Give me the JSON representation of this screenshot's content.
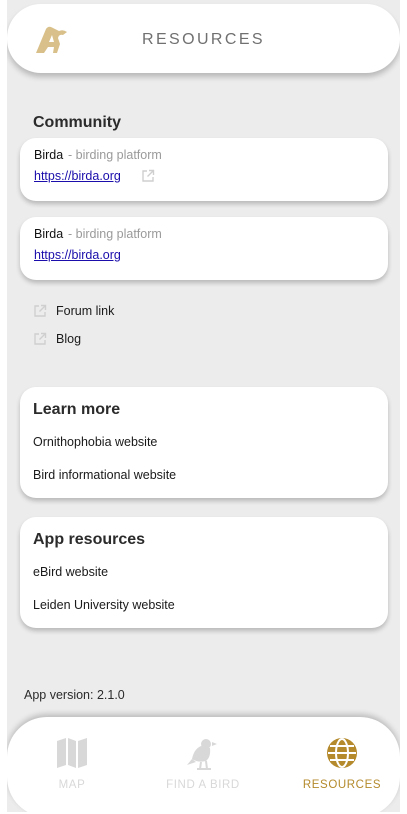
{
  "header": {
    "title": "RESOURCES",
    "logo_icon": "bird-logo-icon"
  },
  "community": {
    "title": "Community",
    "cards": [
      {
        "name": "Birda",
        "description": "- birding platform",
        "url": "https://birda.org",
        "show_external_icon": true
      },
      {
        "name": "Birda",
        "description": "- birding platform",
        "url": "https://birda.org",
        "show_external_icon": false
      }
    ],
    "links": [
      {
        "label": "Forum link",
        "icon": "external-link-icon"
      },
      {
        "label": "Blog",
        "icon": "external-link-icon"
      }
    ]
  },
  "learn_more": {
    "title": "Learn more",
    "items": [
      "Ornithophobia website",
      "Bird informational website"
    ]
  },
  "app_resources": {
    "title": "App resources",
    "items": [
      "eBird website",
      "Leiden University website"
    ]
  },
  "footer": {
    "version": "App version: 2.1.0"
  },
  "nav": {
    "items": [
      {
        "label": "MAP",
        "icon": "map-icon",
        "active": false
      },
      {
        "label": "FIND A BIRD",
        "icon": "bird-icon",
        "active": false
      },
      {
        "label": "RESOURCES",
        "icon": "globe-icon",
        "active": true
      }
    ]
  },
  "colors": {
    "accent": "#b48a2c",
    "link": "#1a0dab",
    "inactive_nav": "#d8d8d8",
    "background": "#ececec"
  }
}
